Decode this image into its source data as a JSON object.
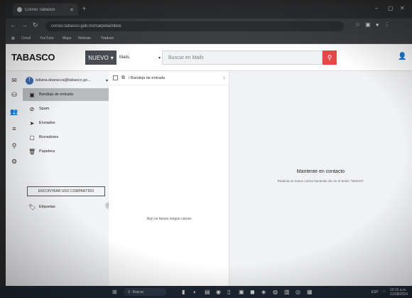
{
  "browser": {
    "tab_title": "Correo Tabasco",
    "url": "correo.tabasco.gob.mx/carpeta/inbox",
    "bookmarks": [
      "Gmail",
      "YouTube",
      "Maps",
      "Noticias",
      "Traducir"
    ]
  },
  "header": {
    "logo": "TABASCO",
    "new_button_label": "NUEVO",
    "search_scope": "Mails",
    "search_placeholder": "Buscar en Mails"
  },
  "account": {
    "name": "tatiana.dearacca@tabasco.go...",
    "avatar_letter": "T"
  },
  "folders": [
    {
      "icon": "inbox-icon",
      "glyph": "▣",
      "label": "Bandeja de entrada",
      "active": true
    },
    {
      "icon": "spam-icon",
      "glyph": "⊘",
      "label": "Spam",
      "active": false
    },
    {
      "icon": "send-icon",
      "glyph": "➤",
      "label": "Enviados",
      "active": false
    },
    {
      "icon": "draft-icon",
      "glyph": "▢",
      "label": "Borradores",
      "active": false
    },
    {
      "icon": "trash-icon",
      "glyph": "🗑",
      "label": "Papelera",
      "active": false
    }
  ],
  "shared_button_label": "ENCONTRAR USO COMPARTIDO",
  "labels_label": "Etiquetas",
  "message_list": {
    "title": "/ Bandeja de entrada",
    "sort_label": "↕",
    "empty_text": "Aún no tienes ningún correo"
  },
  "reader": {
    "title": "Mantente en contacto",
    "subtitle": "Redacta un nuevo correo haciendo clic en el botón \"NUEVO\""
  },
  "taskbar": {
    "search_placeholder": "Buscar",
    "time": "10:15 a.m.",
    "date": "21/08/2024",
    "lang": "ESP"
  }
}
